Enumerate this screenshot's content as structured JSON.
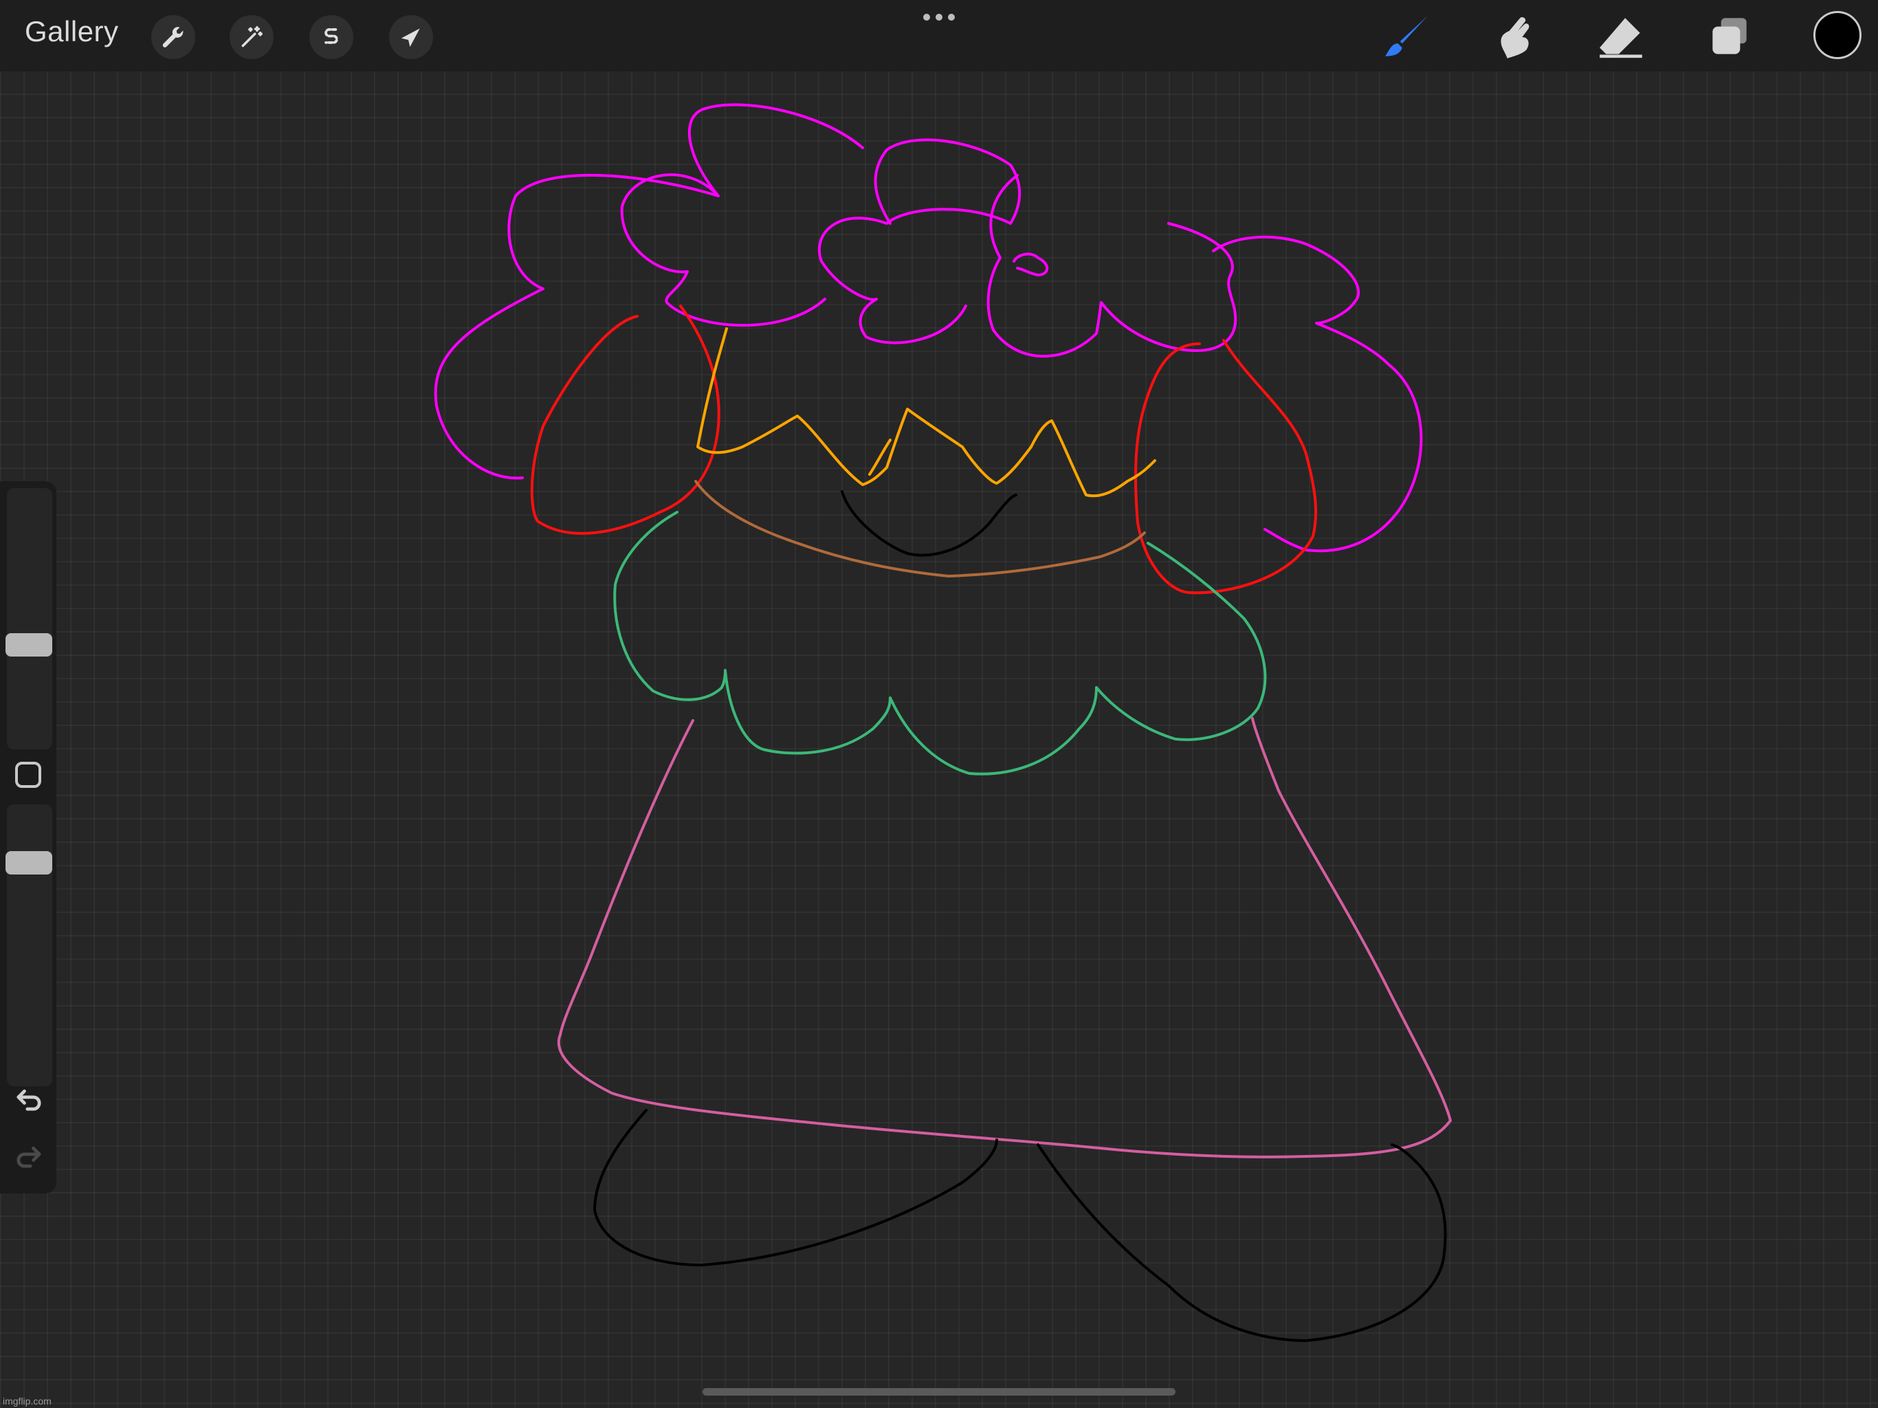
{
  "topbar": {
    "gallery_label": "Gallery",
    "left_tools": [
      {
        "name": "actions",
        "icon": "wrench-icon"
      },
      {
        "name": "adjustments",
        "icon": "magic-wand-icon"
      },
      {
        "name": "selection",
        "icon": "selection-s-icon"
      },
      {
        "name": "transform",
        "icon": "arrow-cursor-icon"
      }
    ],
    "more_icon": "ellipsis-icon",
    "right_tools": [
      {
        "name": "brush",
        "icon": "brush-icon",
        "active": true,
        "color": "#2f7cf6"
      },
      {
        "name": "smudge",
        "icon": "smudge-finger-icon",
        "active": false
      },
      {
        "name": "eraser",
        "icon": "eraser-icon",
        "active": false
      },
      {
        "name": "layers",
        "icon": "layers-icon",
        "active": false
      }
    ],
    "current_color": "#000000"
  },
  "sidebar": {
    "brush_size_level": 0.39,
    "brush_opacity_level": 0.82,
    "undo_icon": "undo-icon",
    "redo_icon": "redo-icon",
    "redo_enabled": false
  },
  "canvas": {
    "background": "#262626",
    "stroke_colors": {
      "hair": "#ff00ff",
      "hair_ribbons": "#ff1010",
      "crown": "#ffa500",
      "face": "#000000",
      "neckline": "#b06a3c",
      "collar": "#3cb878",
      "dress": "#d45ea0",
      "legs": "#000000"
    }
  },
  "watermark": "imgflip.com"
}
